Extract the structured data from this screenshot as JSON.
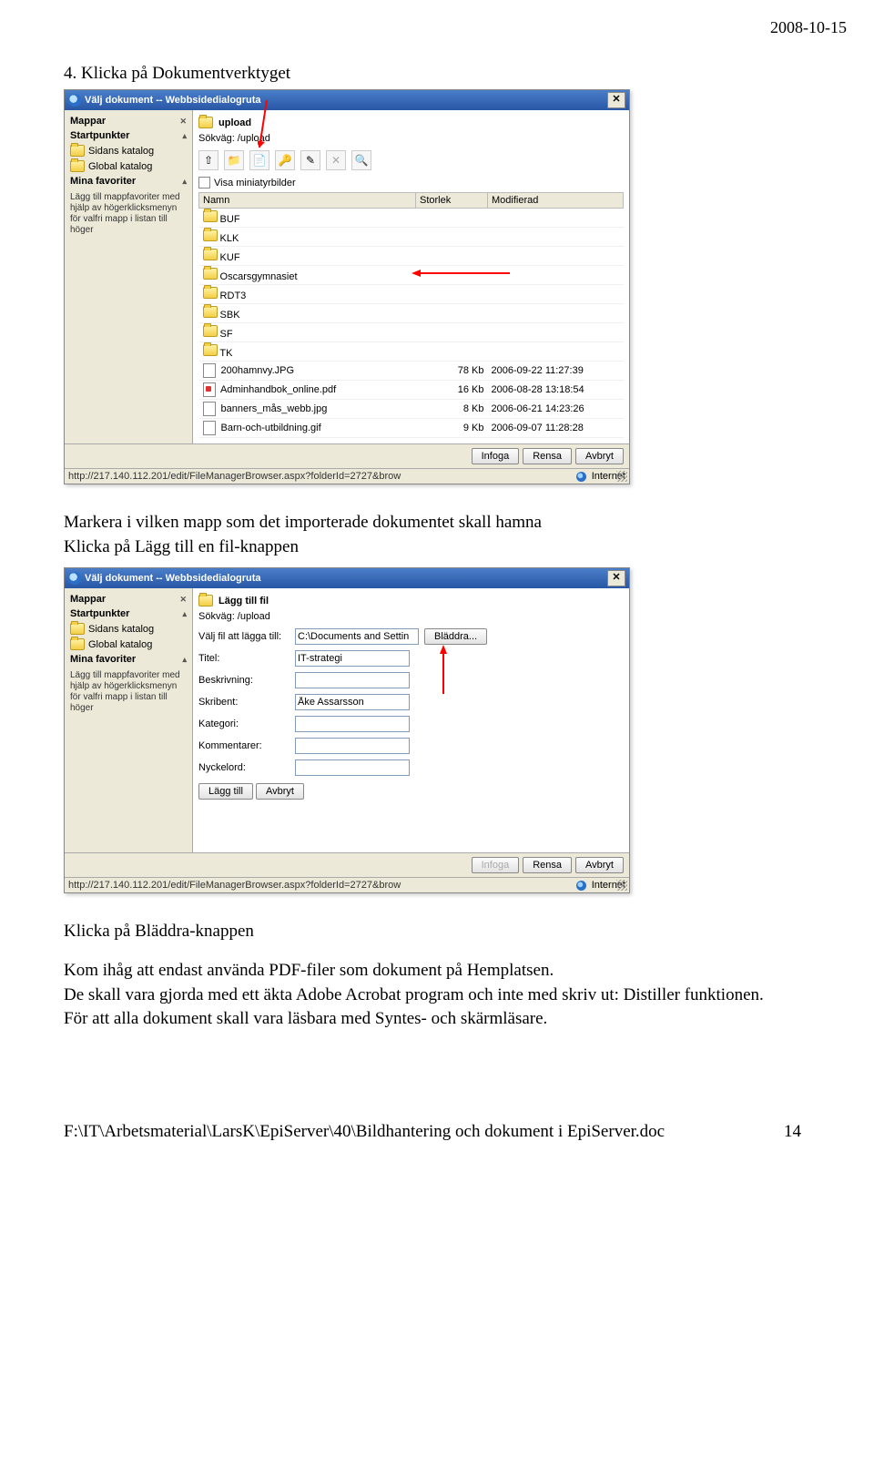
{
  "date": "2008-10-15",
  "section_heading": "4. Klicka på Dokumentverktyget",
  "dialog1": {
    "title": "Välj dokument -- Webbsidedialogruta",
    "sidebar": {
      "hdr_folders": "Mappar",
      "hdr_startpoints": "Startpunkter",
      "item_page_catalog": "Sidans katalog",
      "item_global_catalog": "Global katalog",
      "hdr_favorites": "Mina favoriter",
      "fav_text": "Lägg till mappfavoriter med hjälp av högerklicksmenyn för valfri mapp i listan till höger"
    },
    "breadcrumb": "upload",
    "search_label": "Sökväg: /upload",
    "thumb_label": "Visa miniatyrbilder",
    "columns": {
      "name": "Namn",
      "size": "Storlek",
      "modified": "Modifierad"
    },
    "folders": [
      "BUF",
      "KLK",
      "KUF",
      "Oscarsgymnasiet",
      "RDT3",
      "SBK",
      "SF",
      "TK"
    ],
    "files": [
      {
        "name": "200hamnvy.JPG",
        "size": "78 Kb",
        "modified": "2006-09-22 11:27:39",
        "type": "img"
      },
      {
        "name": "Adminhandbok_online.pdf",
        "size": "16 Kb",
        "modified": "2006-08-28 13:18:54",
        "type": "pdf"
      },
      {
        "name": "banners_mås_webb.jpg",
        "size": "8 Kb",
        "modified": "2006-06-21 14:23:26",
        "type": "img"
      },
      {
        "name": "Barn-och-utbildning.gif",
        "size": "9 Kb",
        "modified": "2006-09-07 11:28:28",
        "type": "img"
      }
    ],
    "btn_insert": "Infoga",
    "btn_clear": "Rensa",
    "btn_cancel": "Avbryt",
    "status_url": "http://217.140.112.201/edit/FileManagerBrowser.aspx?folderId=2727&brow",
    "status_zone": "Internet"
  },
  "mid_text_1": "Markera i vilken mapp som det importerade dokumentet skall hamna",
  "mid_text_2": "Klicka på Lägg till en fil-knappen",
  "dialog2": {
    "title": "Välj dokument -- Webbsidedialogruta",
    "breadcrumb": "Lägg till fil",
    "search_label": "Sökväg: /upload",
    "form": {
      "file_label": "Välj fil att lägga till:",
      "file_value": "C:\\Documents and Settin",
      "browse": "Bläddra...",
      "title_label": "Titel:",
      "title_value": "IT-strategi",
      "desc_label": "Beskrivning:",
      "author_label": "Skribent:",
      "author_value": "Åke Assarsson",
      "category_label": "Kategori:",
      "comments_label": "Kommentarer:",
      "keywords_label": "Nyckelord:"
    },
    "btn_add": "Lägg till",
    "btn_cancel": "Avbryt",
    "bottom_btn_insert": "Infoga",
    "bottom_btn_clear": "Rensa",
    "bottom_btn_cancel": "Avbryt",
    "status_url": "http://217.140.112.201/edit/FileManagerBrowser.aspx?folderId=2727&brow",
    "status_zone": "Internet"
  },
  "tail_1": "Klicka på Bläddra-knappen",
  "tail_2": "Kom ihåg att endast använda PDF-filer som dokument på Hemplatsen.",
  "tail_3": "De skall vara gjorda med ett äkta Adobe Acrobat program och inte med skriv ut: Distiller funktionen.",
  "tail_4": "För att alla dokument skall vara läsbara med Syntes- och skärmläsare.",
  "footer_path": "F:\\IT\\Arbetsmaterial\\LarsK\\EpiServer\\40\\Bildhantering och dokument i EpiServer.doc",
  "footer_page": "14"
}
